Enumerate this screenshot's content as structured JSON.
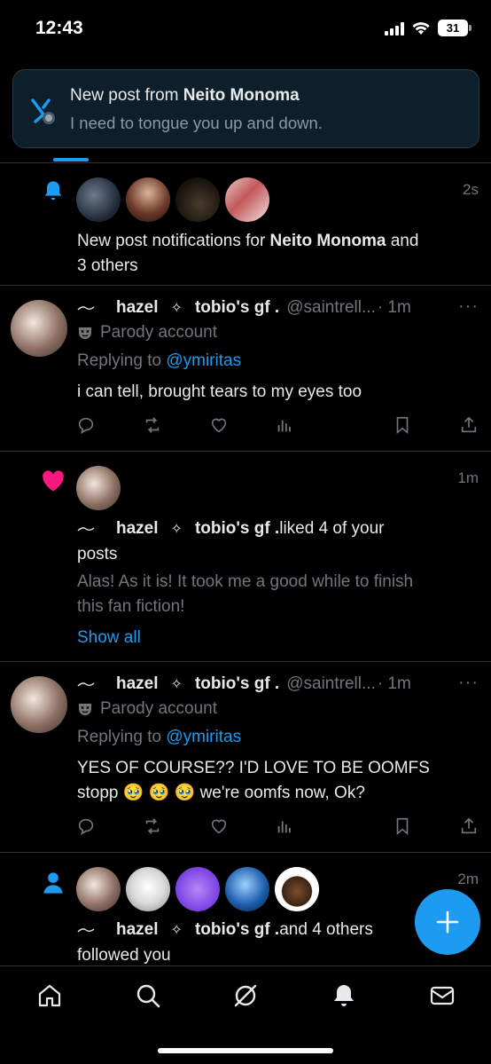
{
  "status_bar": {
    "time": "12:43",
    "battery": "31"
  },
  "toast": {
    "title_prefix": "New post from ",
    "title_name": "Neito Monoma",
    "body": "I need to tongue you up and down."
  },
  "notifications": [
    {
      "type": "new_post",
      "time": "2s",
      "text_prefix": "New post notifications for ",
      "text_name": "Neito Monoma",
      "text_suffix": " and",
      "text_line2": "3 others"
    },
    {
      "type": "reply",
      "name1": "hazel",
      "name2": "tobio's gf .",
      "handle": "@saintrell...",
      "time": "· 1m",
      "parody": "Parody account",
      "replying_prefix": "Replying to ",
      "replying_handle": "@ymiritas",
      "body": "i can tell, brought tears to my eyes too"
    },
    {
      "type": "like",
      "time": "1m",
      "name1": "hazel",
      "name2": "tobio's gf .",
      "action": " liked 4 of your",
      "action_line2": "posts",
      "preview_line1": "Alas! As it is! It took me a good while to finish",
      "preview_line2": "this fan fiction!",
      "show_all": "Show all"
    },
    {
      "type": "reply",
      "name1": "hazel",
      "name2": "tobio's gf .",
      "handle": "@saintrell...",
      "time": "· 1m",
      "parody": "Parody account",
      "replying_prefix": "Replying to ",
      "replying_handle": "@ymiritas",
      "body_line1": "YES OF COURSE?? I'D LOVE TO BE OOMFS",
      "body_line2": "stopp 🥹 🥹 🥹 we're oomfs now, Ok?"
    },
    {
      "type": "follow",
      "time": "2m",
      "name1": "hazel",
      "name2": "tobio's gf .",
      "action": " and 4 others",
      "action_line2": "followed you"
    }
  ],
  "colors": {
    "accent": "#1d9bf0",
    "like": "#f91880",
    "background": "#000000",
    "muted": "#71767b"
  },
  "icons": [
    "bell-icon",
    "heart-icon",
    "person-icon",
    "reply-icon",
    "repost-icon",
    "like-icon",
    "views-icon",
    "bookmark-icon",
    "share-icon",
    "home-icon",
    "search-icon",
    "grok-icon",
    "notifications-icon",
    "messages-icon",
    "compose-icon"
  ]
}
